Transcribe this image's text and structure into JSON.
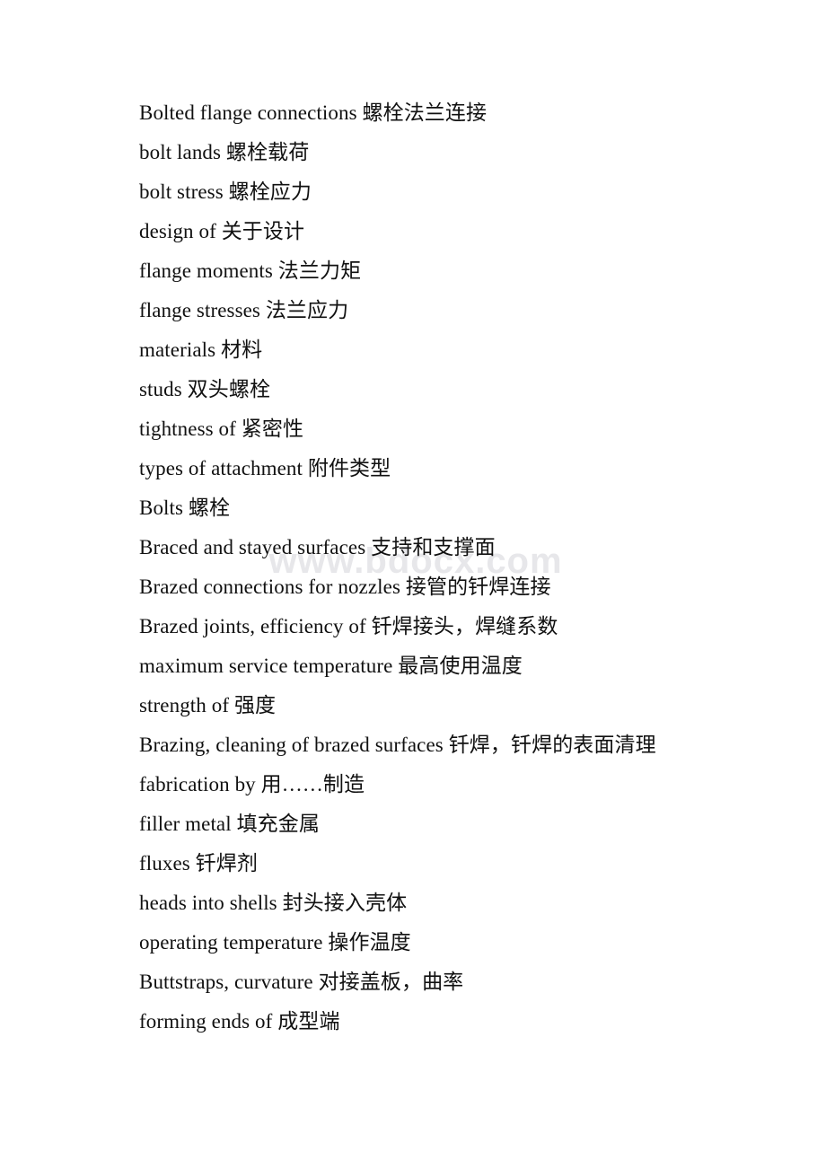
{
  "document": {
    "watermark": "www.bdocx.com",
    "entries": [
      {
        "text": "Bolted flange connections 螺栓法兰连接"
      },
      {
        "text": "bolt lands 螺栓载荷"
      },
      {
        "text": "bolt stress 螺栓应力"
      },
      {
        "text": "design of 关于设计"
      },
      {
        "text": "flange moments 法兰力矩"
      },
      {
        "text": "flange stresses 法兰应力"
      },
      {
        "text": "materials 材料"
      },
      {
        "text": "studs 双头螺栓"
      },
      {
        "text": "tightness of 紧密性"
      },
      {
        "text": "types of attachment 附件类型"
      },
      {
        "text": "Bolts 螺栓"
      },
      {
        "text": "Braced and stayed surfaces 支持和支撑面"
      },
      {
        "text": "Brazed connections for nozzles 接管的钎焊连接"
      },
      {
        "text": "Brazed joints, efficiency of 钎焊接头，焊缝系数"
      },
      {
        "text": "maximum service temperature 最高使用温度"
      },
      {
        "text": "strength of 强度"
      },
      {
        "text": "Brazing, cleaning of brazed surfaces 钎焊，钎焊的表面清理"
      },
      {
        "text": "fabrication by 用……制造"
      },
      {
        "text": "filler metal 填充金属"
      },
      {
        "text": "fluxes 钎焊剂"
      },
      {
        "text": "heads into shells 封头接入壳体"
      },
      {
        "text": "operating temperature 操作温度"
      },
      {
        "text": "Buttstraps, curvature 对接盖板，曲率"
      },
      {
        "text": "forming ends of 成型端"
      }
    ]
  }
}
